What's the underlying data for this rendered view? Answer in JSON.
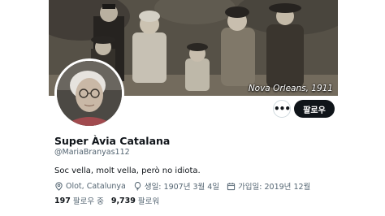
{
  "banner": {
    "caption": "Nova Orleans, 1911",
    "description_icon": "vintage-family-photo"
  },
  "avatar": {
    "icon": "profile-photo"
  },
  "actions": {
    "more_label": "•••",
    "follow_label": "팔로우"
  },
  "profile": {
    "display_name": "Super Àvia Catalana",
    "handle": "@MariaBranyas112",
    "bio": "Soc vella, molt vella, però no idiota.",
    "location": "Olot, Catalunya",
    "birthdate": "생일: 1907년 3월 4일",
    "joined": "가입일: 2019년 12월"
  },
  "stats": {
    "following_count": "197",
    "following_label": "팔로우 중",
    "followers_count": "9,739",
    "followers_label": "팔로워"
  },
  "colors": {
    "text_primary": "#0f1419",
    "text_secondary": "#536471",
    "button_dark": "#0f1419",
    "border": "#cfd9de"
  }
}
